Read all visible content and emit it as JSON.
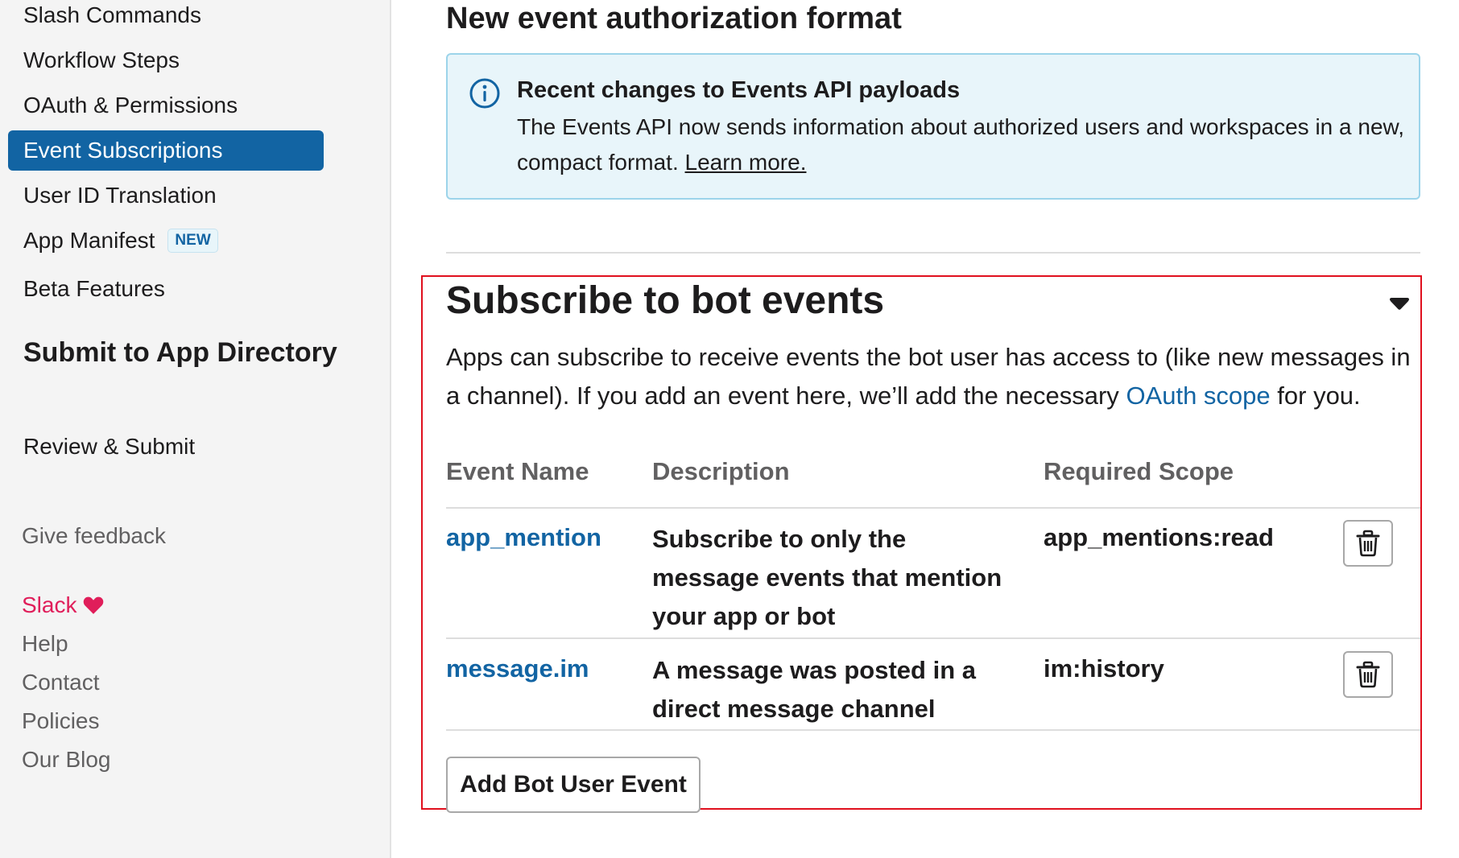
{
  "sidebar": {
    "items": [
      {
        "label": "Slash Commands",
        "active": false
      },
      {
        "label": "Workflow Steps",
        "active": false
      },
      {
        "label": "OAuth & Permissions",
        "active": false
      },
      {
        "label": "Event Subscriptions",
        "active": true
      },
      {
        "label": "User ID Translation",
        "active": false
      },
      {
        "label": "App Manifest",
        "badge": "NEW",
        "active": false
      },
      {
        "label": "Beta Features",
        "active": false
      }
    ],
    "submit_heading": "Submit to App Directory",
    "submit_items": [
      {
        "label": "Review & Submit"
      }
    ],
    "feedback": "Give feedback",
    "footer": {
      "brand": "Slack",
      "links": [
        "Help",
        "Contact",
        "Policies",
        "Our Blog"
      ]
    }
  },
  "main": {
    "title": "New event authorization format",
    "notice": {
      "icon": "info-icon",
      "title": "Recent changes to Events API payloads",
      "body": "The Events API now sends information about authorized users and workspaces in a new, compact format.",
      "link": "Learn more."
    },
    "bot_events": {
      "title": "Subscribe to bot events",
      "desc_part1": "Apps can subscribe to receive events the bot user has access to (like new messages in a channel). If you add an event here, we’ll add the necessary",
      "desc_link": "OAuth scope",
      "desc_part2": "for you.",
      "columns": [
        "Event Name",
        "Description",
        "Required Scope"
      ],
      "rows": [
        {
          "name": "app_mention",
          "description": "Subscribe to only the message events that mention your app or bot",
          "scope": "app_mentions:read"
        },
        {
          "name": "message.im",
          "description": "A message was posted in a direct message channel",
          "scope": "im:history"
        }
      ],
      "add_button": "Add Bot User Event"
    }
  },
  "colors": {
    "accent": "#1264a3",
    "highlight_border": "#e0101e",
    "notice_bg": "#e8f5fa",
    "brand_pink": "#e01e5a"
  }
}
